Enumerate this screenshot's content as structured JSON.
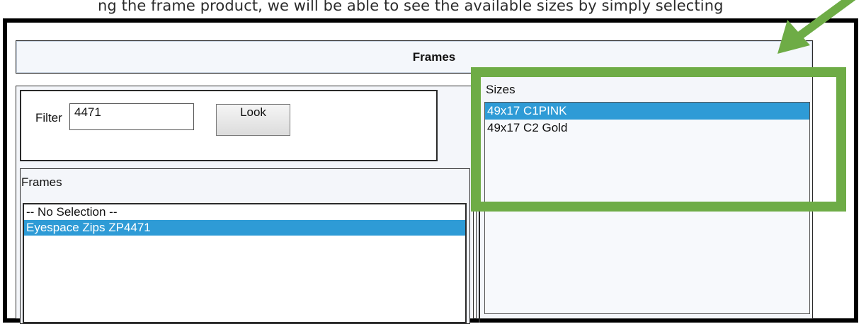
{
  "instruction_text": "ng the frame product, we will be able to see the available sizes by simply selecting",
  "header": {
    "title": "Frames"
  },
  "filter": {
    "label": "Filter",
    "value": "4471",
    "look_button": "Look"
  },
  "frames": {
    "label": "Frames",
    "items": [
      {
        "label": "-- No Selection --",
        "selected": false
      },
      {
        "label": "Eyespace Zips ZP4471",
        "selected": true
      }
    ]
  },
  "sizes": {
    "label": "Sizes",
    "items": [
      {
        "label": "49x17 C1PINK",
        "selected": true
      },
      {
        "label": "49x17 C2 Gold",
        "selected": false
      }
    ]
  },
  "annotation": {
    "highlight_color": "#6eac46",
    "arrow_icon": "arrow-down-left-icon"
  },
  "colors": {
    "selection": "#2e9bd6",
    "window_border": "#000000"
  }
}
